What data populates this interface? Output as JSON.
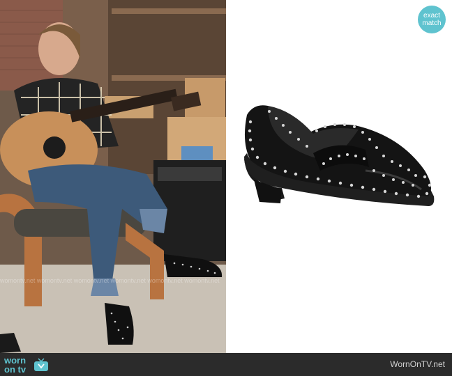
{
  "badge": {
    "line1": "exact",
    "line2": "match"
  },
  "footer": {
    "logo_top": "worn",
    "logo_bottom": "on tv",
    "site": "WornOnTV.net"
  },
  "watermark": {
    "text": "womontv.net  womontv.net  womontv.net  womontv.net  womontv.net  womontv.net"
  },
  "colors": {
    "accent": "#5fc3cf",
    "footer_bg": "#2b2b2b"
  }
}
